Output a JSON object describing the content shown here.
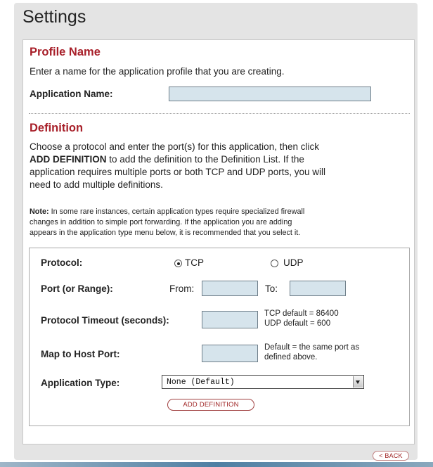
{
  "page": {
    "title": "Settings"
  },
  "profile": {
    "heading": "Profile Name",
    "description": "Enter a name for the application profile that you are creating.",
    "app_name_label": "Application Name:",
    "app_name_value": ""
  },
  "definition": {
    "heading": "Definition",
    "desc_line1": "Choose a protocol and enter the port(s) for this application, then click",
    "desc_line2_bold": "ADD DEFINITION",
    "desc_line2_rest": " to add the definition to the Definition List. If the",
    "desc_line3": "application requires multiple ports or both TCP and UDP ports, you will",
    "desc_line4": "need to add multiple definitions.",
    "note_bold": "Note:",
    "note_line1": " In some rare instances, certain application types require specialized firewall",
    "note_line2": "changes in addition to simple port forwarding. If the application you are adding",
    "note_line3": "appears in the application type menu below, it is recommended that you select it."
  },
  "form": {
    "protocol_label": "Protocol:",
    "protocol_options": [
      "TCP",
      "UDP"
    ],
    "protocol_selected": "TCP",
    "port_label": "Port (or Range):",
    "from_label": "From:",
    "from_value": "",
    "to_label": "To:",
    "to_value": "",
    "timeout_label": "Protocol Timeout (seconds):",
    "timeout_value": "",
    "timeout_hint_tcp": "TCP default = 86400",
    "timeout_hint_udp": "UDP default = 600",
    "map_label": "Map to Host Port:",
    "map_value": "",
    "map_hint_line1": "Default = the same port as",
    "map_hint_line2": "defined above.",
    "app_type_label": "Application Type:",
    "app_type_selected": "None (Default)",
    "add_button": "ADD DEFINITION"
  },
  "footer": {
    "back_button": "< BACK"
  },
  "colors": {
    "heading": "#a8202a",
    "input_bg": "#d6e4ec",
    "outer_bg": "#e4e4e4"
  }
}
